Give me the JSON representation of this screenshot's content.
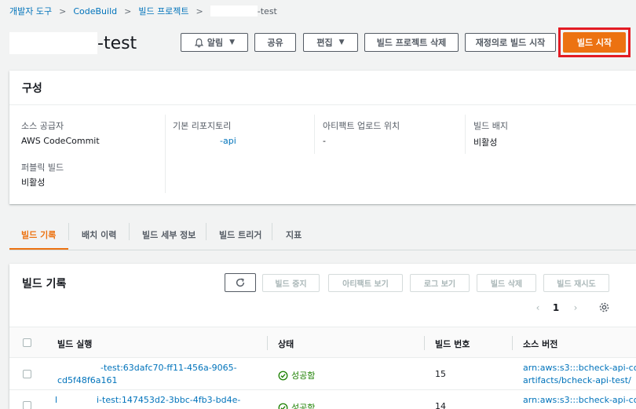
{
  "breadcrumb": {
    "items": [
      "개발자 도구",
      "CodeBuild",
      "빌드 프로젝트"
    ],
    "current": "-test"
  },
  "page": {
    "title": "-test"
  },
  "header_buttons": {
    "notify": "알림",
    "share": "공유",
    "edit": "편집",
    "delete": "빌드 프로젝트 삭제",
    "retry": "재정의로 빌드 시작",
    "start": "빌드 시작"
  },
  "config": {
    "title": "구성",
    "source_provider_label": "소스 공급자",
    "source_provider_value": "AWS CodeCommit",
    "public_build_label": "퍼블릭 빌드",
    "public_build_value": "비활성",
    "primary_repo_label": "기본 리포지토리",
    "primary_repo_value": "-api",
    "artifact_label": "아티팩트 업로드 위치",
    "artifact_value": "-",
    "badge_label": "빌드 배지",
    "badge_value": "비활성"
  },
  "tabs": [
    "빌드 기록",
    "배치 이력",
    "빌드 세부 정보",
    "빌드 트리거",
    "지표"
  ],
  "history": {
    "title": "빌드 기록",
    "buttons": [
      "빌드 중지",
      "아티팩트 보기",
      "로그 보기",
      "빌드 삭제",
      "빌드 재시도"
    ],
    "page": "1",
    "columns": [
      "빌드 실행",
      "상태",
      "빌드 번호",
      "소스 버전"
    ],
    "rows": [
      {
        "run_line1": "-test:63dafc70-ff11-456a-9065-",
        "run_line2": "cd5f48f6a161",
        "status": "성공함",
        "number": "15",
        "source_line1": "arn:aws:s3:::bcheck-api-co",
        "source_line2": "artifacts/bcheck-api-test/"
      },
      {
        "run_line1": "i-test:147453d2-3bbc-4fb3-bd4e-",
        "run_line2": "",
        "status": "성공함",
        "number": "14",
        "source_line1": "arn:aws:s3:::bcheck-api-co",
        "source_line2": ""
      }
    ]
  },
  "colors": {
    "accent": "#ec7211",
    "link": "#0073bb",
    "success": "#1d8102",
    "highlight": "#e31b23"
  }
}
